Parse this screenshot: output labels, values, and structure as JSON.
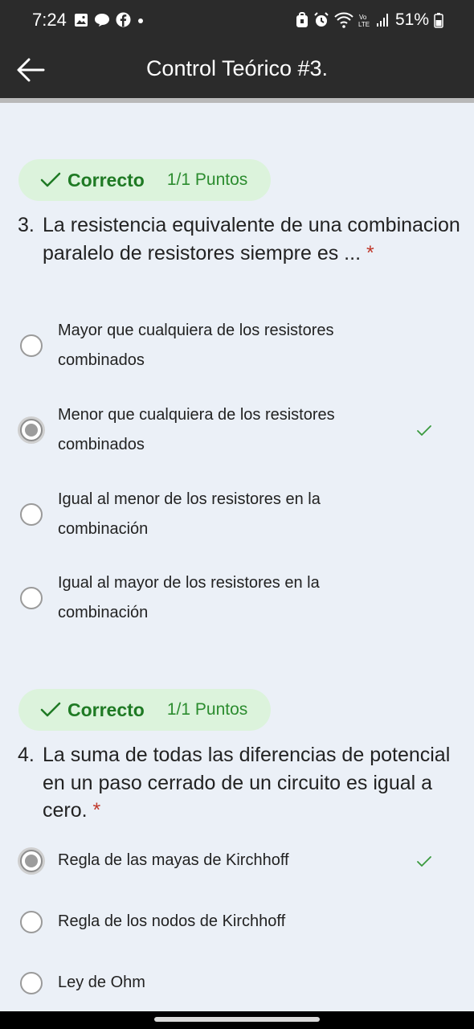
{
  "status_bar": {
    "time": "7:24",
    "battery": "51%"
  },
  "app_bar": {
    "title": "Control Teórico #3."
  },
  "questions": [
    {
      "result": "Correcto",
      "points": "1/1 Puntos",
      "number": "3.",
      "text": "La resistencia equivalente de una combinacion paralelo de resistores siempre es ...",
      "required_mark": "*",
      "options": [
        {
          "label": "Mayor que cualquiera de los resistores combinados",
          "selected": false,
          "correct": false
        },
        {
          "label": "Menor que cualquiera de los resistores combinados",
          "selected": true,
          "correct": true
        },
        {
          "label": "Igual al menor de los resistores en la combinación",
          "selected": false,
          "correct": false
        },
        {
          "label": "Igual al mayor de los resistores en la combinación",
          "selected": false,
          "correct": false
        }
      ]
    },
    {
      "result": "Correcto",
      "points": "1/1 Puntos",
      "number": "4.",
      "text": "La suma de todas las diferencias de potencial en un paso cerrado de un circuito es igual a cero.",
      "required_mark": "*",
      "options": [
        {
          "label": "Regla de las mayas de Kirchhoff",
          "selected": true,
          "correct": true
        },
        {
          "label": "Regla de los nodos de Kirchhoff",
          "selected": false,
          "correct": false
        },
        {
          "label": "Ley de Ohm",
          "selected": false,
          "correct": false
        }
      ]
    }
  ],
  "colors": {
    "success": "#1f7a24",
    "badge_bg": "#dcf3dc",
    "required": "#c0392b",
    "bar": "#2b2b2b"
  },
  "icons": {
    "back": "arrow-left-icon",
    "check": "check-icon"
  }
}
